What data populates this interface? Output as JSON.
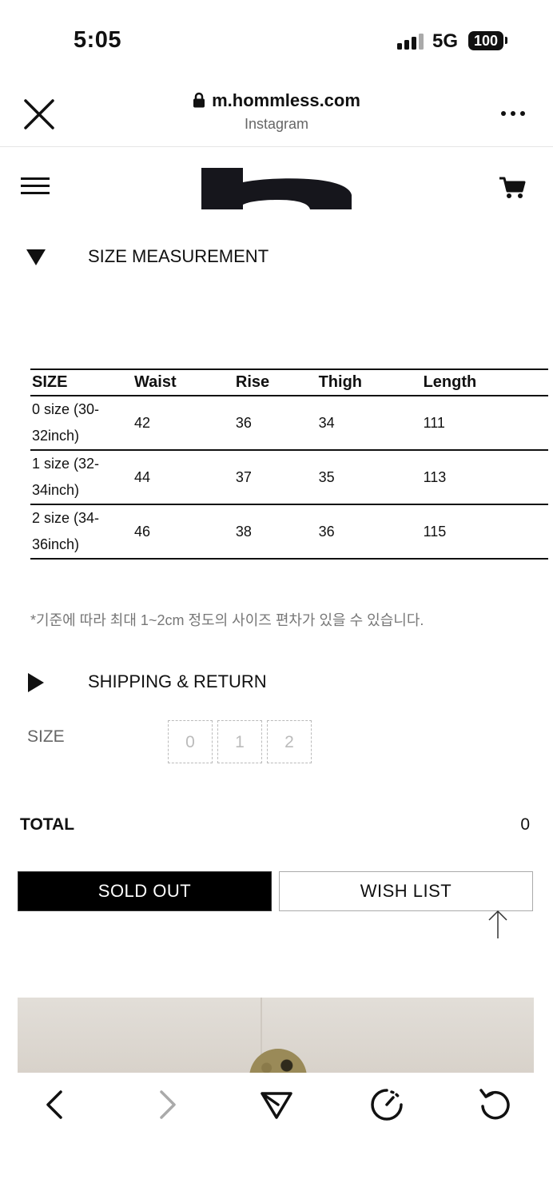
{
  "status_bar": {
    "time": "5:05",
    "network": "5G",
    "battery": "100"
  },
  "browser": {
    "url": "m.hommless.com",
    "source": "Instagram"
  },
  "site": {
    "logo_icon": "hommless-logo",
    "cart_icon": "cart-icon",
    "menu_icon": "hamburger-icon"
  },
  "size_measurement": {
    "title": "SIZE MEASUREMENT",
    "columns": [
      "SIZE",
      "Waist",
      "Rise",
      "Thigh",
      "Length"
    ],
    "rows": [
      {
        "size_line1": "0 size (30-",
        "size_line2": "32inch)",
        "waist": "42",
        "rise": "36",
        "thigh": "34",
        "length": "111"
      },
      {
        "size_line1": "1 size (32-",
        "size_line2": "34inch)",
        "waist": "44",
        "rise": "37",
        "thigh": "35",
        "length": "113"
      },
      {
        "size_line1": "2 size (34-",
        "size_line2": "36inch)",
        "waist": "46",
        "rise": "38",
        "thigh": "36",
        "length": "115"
      }
    ],
    "note": "*기준에 따라 최대 1~2cm 정도의 사이즈 편차가 있을 수 있습니다."
  },
  "shipping": {
    "title": "SHIPPING & RETURN"
  },
  "size_select": {
    "label": "SIZE",
    "options": [
      "0",
      "1",
      "2"
    ]
  },
  "total": {
    "label": "TOTAL",
    "value": "0"
  },
  "buttons": {
    "sold_out": "SOLD OUT",
    "wish_list": "WISH LIST"
  },
  "toolbar": {
    "icons": [
      "chevron-left-icon",
      "chevron-right-icon",
      "share-icon",
      "speed-icon",
      "refresh-icon"
    ]
  },
  "colors": {
    "text": "#111111",
    "muted": "#777777",
    "button_dark": "#000000",
    "disabled": "#bbbbbb"
  }
}
